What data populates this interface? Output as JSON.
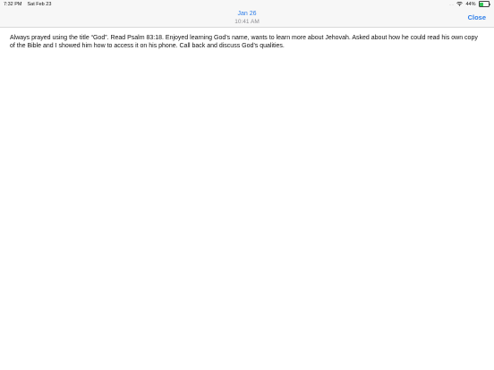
{
  "status_bar": {
    "time": "7:32 PM",
    "date": "Sat Feb 23",
    "signal": "....",
    "battery_percent": "44%",
    "battery_level": 0.44,
    "battery_color": "#34c759"
  },
  "nav": {
    "date": "Jan 26",
    "time": "10:41 AM",
    "close_label": "Close",
    "accent_color": "#2e7ee8"
  },
  "note": {
    "text": "Always prayed using the title “God”. Read Psalm 83:18. Enjoyed learning God’s name, wants to learn more about Jehovah. Asked about how he could read his own copy of the Bible and I showed him how to access it on his phone. Call back and discuss God’s qualities."
  }
}
